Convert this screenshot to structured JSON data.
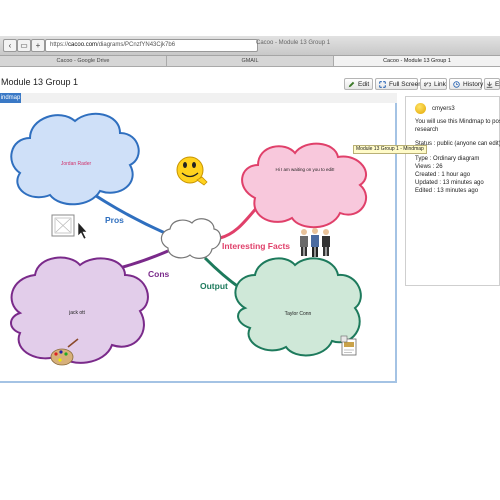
{
  "browser": {
    "url_prefix": "https://",
    "url_host": "cacoo.com",
    "url_path": "/diagrams/PCnzfYN43Cjk7b6",
    "window_title": "Cacoo - Module 13 Group 1",
    "tabs": [
      "Cacoo - Google Drive",
      "GMAIL",
      "Cacoo - Module 13 Group 1"
    ]
  },
  "header": {
    "doc_title": "Module 13 Group 1",
    "buttons": {
      "edit": "Edit",
      "fullscreen": "Full Screen",
      "link": "Link",
      "history": "History",
      "export": "Ex"
    }
  },
  "diagram_tab": {
    "label": "indmap"
  },
  "mindmap": {
    "top_left_cloud_text": "Jordan Rader",
    "top_right_cloud_text": "Hi I am waiting on you to edit!",
    "bottom_left_cloud_text": "jack ott",
    "bottom_right_cloud_text": "Taylor Conn",
    "branch_pros": "Pros",
    "branch_cons": "Cons",
    "branch_output": "Output",
    "branch_facts": "Interesting Facts",
    "colors": {
      "pros": "#2f6fbf",
      "cons": "#7a2a8a",
      "output": "#1d7a5c",
      "facts": "#e0406a",
      "cloud_blue": "#cfe0f8",
      "cloud_pink": "#f8c8dc",
      "cloud_purple": "#e2cdea",
      "cloud_green": "#cfe8d8"
    },
    "icons": [
      "smiley-icon",
      "image-placeholder-icon",
      "people-icon",
      "palette-icon",
      "document-icon"
    ]
  },
  "sidebar": {
    "user": "cmyers3",
    "description_1": "You will use this Mindmap to post y",
    "description_2": "research",
    "status": "Status : public (anyone can edit)",
    "type": "Type : Ordinary diagram",
    "views": "Views : 26",
    "created": "Created : 1 hour ago",
    "updated": "Updated : 13 minutes ago",
    "edited": "Edited : 13 minutes ago"
  },
  "tooltip": {
    "text": "Module 13 Group 1 - Mindmap"
  }
}
